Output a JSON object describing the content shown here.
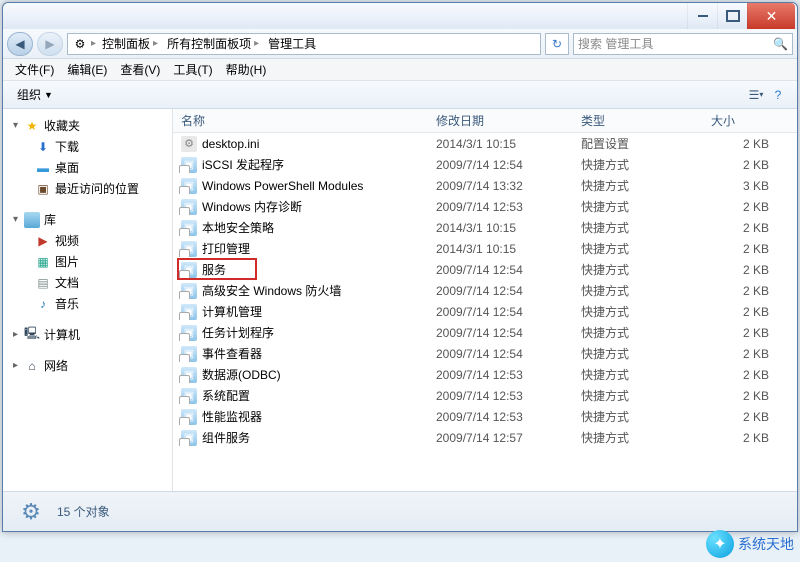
{
  "titlebar": {},
  "breadcrumb": {
    "items": [
      "控制面板",
      "所有控制面板项",
      "管理工具"
    ]
  },
  "search": {
    "placeholder": "搜索 管理工具"
  },
  "menu": {
    "file": "文件(F)",
    "edit": "编辑(E)",
    "view": "查看(V)",
    "tools": "工具(T)",
    "help": "帮助(H)"
  },
  "toolbar": {
    "organize": "组织"
  },
  "sidebar": {
    "fav": "收藏夹",
    "downloads": "下载",
    "desktop": "桌面",
    "recent": "最近访问的位置",
    "libraries": "库",
    "videos": "视频",
    "pictures": "图片",
    "documents": "文档",
    "music": "音乐",
    "computer": "计算机",
    "network": "网络"
  },
  "columns": {
    "name": "名称",
    "date": "修改日期",
    "type": "类型",
    "size": "大小"
  },
  "files": [
    {
      "name": "desktop.ini",
      "date": "2014/3/1 10:15",
      "type": "配置设置",
      "size": "2 KB",
      "icon": "ini"
    },
    {
      "name": "iSCSI 发起程序",
      "date": "2009/7/14 12:54",
      "type": "快捷方式",
      "size": "2 KB",
      "icon": "lnk"
    },
    {
      "name": "Windows PowerShell Modules",
      "date": "2009/7/14 13:32",
      "type": "快捷方式",
      "size": "3 KB",
      "icon": "lnk"
    },
    {
      "name": "Windows 内存诊断",
      "date": "2009/7/14 12:53",
      "type": "快捷方式",
      "size": "2 KB",
      "icon": "lnk"
    },
    {
      "name": "本地安全策略",
      "date": "2014/3/1 10:15",
      "type": "快捷方式",
      "size": "2 KB",
      "icon": "lnk"
    },
    {
      "name": "打印管理",
      "date": "2014/3/1 10:15",
      "type": "快捷方式",
      "size": "2 KB",
      "icon": "lnk"
    },
    {
      "name": "服务",
      "date": "2009/7/14 12:54",
      "type": "快捷方式",
      "size": "2 KB",
      "icon": "lnk",
      "highlight": true
    },
    {
      "name": "高级安全 Windows 防火墙",
      "date": "2009/7/14 12:54",
      "type": "快捷方式",
      "size": "2 KB",
      "icon": "lnk"
    },
    {
      "name": "计算机管理",
      "date": "2009/7/14 12:54",
      "type": "快捷方式",
      "size": "2 KB",
      "icon": "lnk"
    },
    {
      "name": "任务计划程序",
      "date": "2009/7/14 12:54",
      "type": "快捷方式",
      "size": "2 KB",
      "icon": "lnk"
    },
    {
      "name": "事件查看器",
      "date": "2009/7/14 12:54",
      "type": "快捷方式",
      "size": "2 KB",
      "icon": "lnk"
    },
    {
      "name": "数据源(ODBC)",
      "date": "2009/7/14 12:53",
      "type": "快捷方式",
      "size": "2 KB",
      "icon": "lnk"
    },
    {
      "name": "系统配置",
      "date": "2009/7/14 12:53",
      "type": "快捷方式",
      "size": "2 KB",
      "icon": "lnk"
    },
    {
      "name": "性能监视器",
      "date": "2009/7/14 12:53",
      "type": "快捷方式",
      "size": "2 KB",
      "icon": "lnk"
    },
    {
      "name": "组件服务",
      "date": "2009/7/14 12:57",
      "type": "快捷方式",
      "size": "2 KB",
      "icon": "lnk"
    }
  ],
  "status": {
    "count": "15 个对象"
  },
  "watermark": {
    "text": "系统天地"
  }
}
